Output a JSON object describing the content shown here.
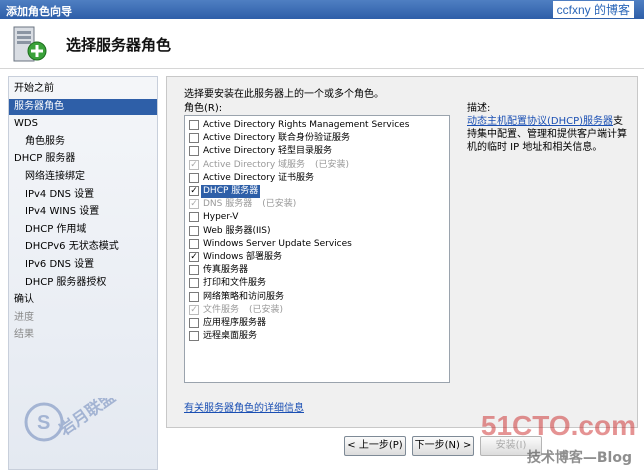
{
  "window": {
    "title": "添加角色向导"
  },
  "watermark_top": "ccfxny 的博客",
  "header": {
    "title": "选择服务器角色"
  },
  "nav": {
    "items": [
      {
        "label": "开始之前",
        "level": 0,
        "state": "normal"
      },
      {
        "label": "服务器角色",
        "level": 0,
        "state": "active"
      },
      {
        "label": "WDS",
        "level": 0,
        "state": "normal"
      },
      {
        "label": "角色服务",
        "level": 1,
        "state": "normal"
      },
      {
        "label": "DHCP 服务器",
        "level": 0,
        "state": "normal"
      },
      {
        "label": "网络连接绑定",
        "level": 1,
        "state": "normal"
      },
      {
        "label": "IPv4 DNS 设置",
        "level": 1,
        "state": "normal"
      },
      {
        "label": "IPv4 WINS 设置",
        "level": 1,
        "state": "normal"
      },
      {
        "label": "DHCP 作用域",
        "level": 1,
        "state": "normal"
      },
      {
        "label": "DHCPv6 无状态模式",
        "level": 1,
        "state": "normal"
      },
      {
        "label": "IPv6 DNS 设置",
        "level": 1,
        "state": "normal"
      },
      {
        "label": "DHCP 服务器授权",
        "level": 1,
        "state": "normal"
      },
      {
        "label": "确认",
        "level": 0,
        "state": "normal"
      },
      {
        "label": "进度",
        "level": 0,
        "state": "dim"
      },
      {
        "label": "结果",
        "level": 0,
        "state": "dim"
      }
    ]
  },
  "content": {
    "instruction": "选择要安装在此服务器上的一个或多个角色。",
    "roles_label": "角色(R):",
    "description_label": "描述:",
    "roles": [
      {
        "name": "Active Directory Rights Management Services",
        "checked": false,
        "disabled": false,
        "note": ""
      },
      {
        "name": "Active Directory 联合身份验证服务",
        "checked": false,
        "disabled": false,
        "note": ""
      },
      {
        "name": "Active Directory 轻型目录服务",
        "checked": false,
        "disabled": false,
        "note": ""
      },
      {
        "name": "Active Directory 域服务",
        "checked": true,
        "disabled": true,
        "note": "(已安装)"
      },
      {
        "name": "Active Directory 证书服务",
        "checked": false,
        "disabled": false,
        "note": ""
      },
      {
        "name": "DHCP 服务器",
        "checked": true,
        "disabled": false,
        "note": "",
        "selected": true
      },
      {
        "name": "DNS 服务器",
        "checked": true,
        "disabled": true,
        "note": "(已安装)"
      },
      {
        "name": "Hyper-V",
        "checked": false,
        "disabled": false,
        "note": ""
      },
      {
        "name": "Web 服务器(IIS)",
        "checked": false,
        "disabled": false,
        "note": ""
      },
      {
        "name": "Windows Server Update Services",
        "checked": false,
        "disabled": false,
        "note": ""
      },
      {
        "name": "Windows 部署服务",
        "checked": true,
        "disabled": false,
        "note": ""
      },
      {
        "name": "传真服务器",
        "checked": false,
        "disabled": false,
        "note": ""
      },
      {
        "name": "打印和文件服务",
        "checked": false,
        "disabled": false,
        "note": ""
      },
      {
        "name": "网络策略和访问服务",
        "checked": false,
        "disabled": false,
        "note": ""
      },
      {
        "name": "文件服务",
        "checked": true,
        "disabled": true,
        "note": "(已安装)"
      },
      {
        "name": "应用程序服务器",
        "checked": false,
        "disabled": false,
        "note": ""
      },
      {
        "name": "远程桌面服务",
        "checked": false,
        "disabled": false,
        "note": ""
      }
    ],
    "description_link": "动态主机配置协议(DHCP)服务器",
    "description_text": "支持集中配置、管理和提供客户端计算机的临时 IP 地址和相关信息。",
    "more_info_link": "有关服务器角色的详细信息"
  },
  "buttons": {
    "prev": "< 上一步(P)",
    "next": "下一步(N) >",
    "install": "安装(I)"
  },
  "watermarks": {
    "logo_text": "岩月联盟",
    "site": "51CTO.com",
    "blog": "技术博客",
    "blog_suffix": "Blog"
  }
}
